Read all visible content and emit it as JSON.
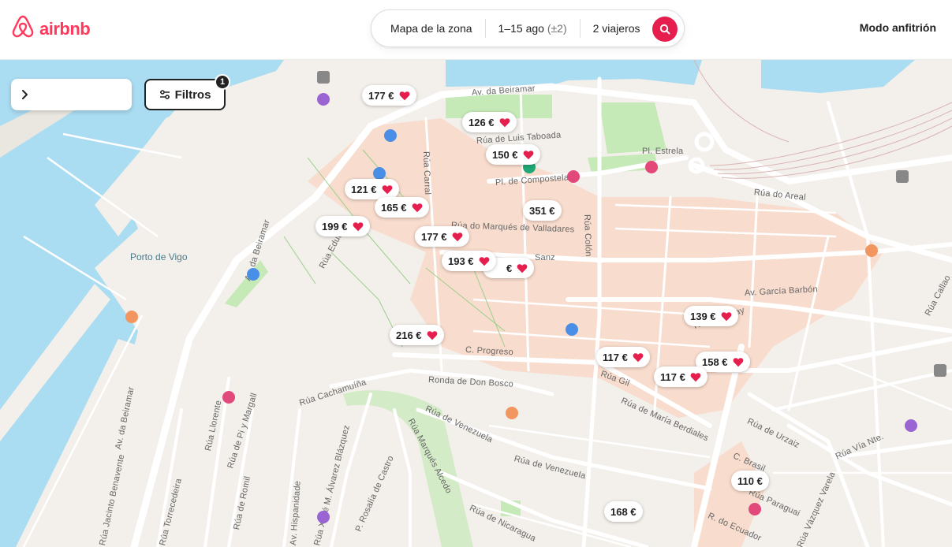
{
  "header": {
    "brand": "airbnb",
    "search": {
      "location": "Mapa de la zona",
      "dates": "1–15 ago",
      "dates_flex": "(±2)",
      "guests": "2 viajeros"
    },
    "host_link": "Modo anfitrión"
  },
  "map": {
    "filters_label": "Filtros",
    "filters_count": "1",
    "water_labels": [
      "Porto de Vigo"
    ],
    "streets": [
      "Av. da Beiramar",
      "Rúa de Luis Taboada",
      "Pl. Estrela",
      "Pl. de Compostela",
      "Rúa Carral",
      "Rúa do Areal",
      "Rúa do Marqués de Valladares",
      "Rúa Colón",
      "Sanz",
      "Av. García Barbón",
      "C. Progreso",
      "Ronda de Don Bosco",
      "Rúa Cachamuíña",
      "Rúa de Venezuela",
      "Rúa Marqués Alcedo",
      "Rúa de María Berdiales",
      "Rúa Gil",
      "Rúa Uruguay",
      "Rúa de Urzaiz",
      "Rúa Vía Nte.",
      "C. Brasil",
      "Rúa Paraguai",
      "R. do Ecuador",
      "Rúa Vázquez Varela",
      "Rúa de Nicaragua",
      "Rúa Llorente",
      "Rúa de Pi y Margall",
      "Rúa de Romil",
      "Rúa Torrecedeira",
      "Rúa Jacinto Benavente",
      "Av. Hispanidade",
      "Rúa Xosé M. Álvarez Blázquez",
      "P. Rosalía de Castro",
      "Rúa Eduardo",
      "Rúa Callao"
    ],
    "pins": [
      {
        "price": "177 €",
        "fav": true
      },
      {
        "price": "126 €",
        "fav": true
      },
      {
        "price": "150 €",
        "fav": true
      },
      {
        "price": "121 €",
        "fav": true
      },
      {
        "price": "165 €",
        "fav": true
      },
      {
        "price": "351 €",
        "fav": false
      },
      {
        "price": "199 €",
        "fav": true
      },
      {
        "price": "177 €",
        "fav": true
      },
      {
        "price": "193 €",
        "fav": true
      },
      {
        "price": "€",
        "fav": true
      },
      {
        "price": "216 €",
        "fav": true
      },
      {
        "price": "139 €",
        "fav": true
      },
      {
        "price": "117 €",
        "fav": true
      },
      {
        "price": "158 €",
        "fav": true
      },
      {
        "price": "117 €",
        "fav": true
      },
      {
        "price": "110 €",
        "fav": false
      },
      {
        "price": "168 €",
        "fav": false
      }
    ]
  },
  "colors": {
    "brand": "#FF385C",
    "search_button": "#E61E4D",
    "water": "#aadcf2",
    "land": "#f3efea",
    "urban": "#f8dccd",
    "park": "#c6e9b8"
  }
}
